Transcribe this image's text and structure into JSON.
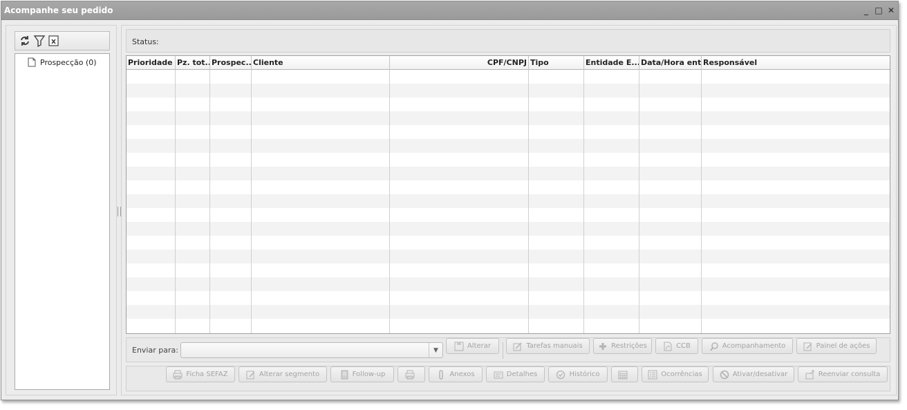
{
  "window": {
    "title": "Acompanhe seu pedido",
    "controls": [
      "_",
      "□",
      "✕"
    ]
  },
  "tree": {
    "toolbar_icons": [
      "refresh-icon",
      "filter-icon",
      "excel-export-icon"
    ],
    "items": [
      {
        "label": "Prospecção (0)",
        "icon": "document-icon"
      }
    ]
  },
  "status": {
    "label": "Status:"
  },
  "grid": {
    "columns": [
      "Prioridade",
      "Pz. tot...",
      "Prospec...",
      "Cliente",
      "CPF/CNPJ",
      "Tipo",
      "Entidade E...",
      "Data/Hora ent...",
      "Responsável"
    ],
    "rows": []
  },
  "send": {
    "label": "Enviar para:",
    "selected": "",
    "buttons": [
      "Alterar",
      "Tarefas manuais",
      "Restrições",
      "CCB",
      "Acompanhamento",
      "Painel de ações"
    ]
  },
  "actions": {
    "buttons": [
      "Ficha SEFAZ",
      "Alterar segmento",
      "Follow-up",
      "",
      "Anexos",
      "Detalhes",
      "Histórico",
      "",
      "Ocorrências",
      "Ativar/desativar",
      "Reenviar consulta"
    ]
  },
  "colors": {
    "titlebar": "#9f9f9f",
    "disabled_text": "#a3a3a3",
    "row_alt": "#f3f3f3"
  }
}
